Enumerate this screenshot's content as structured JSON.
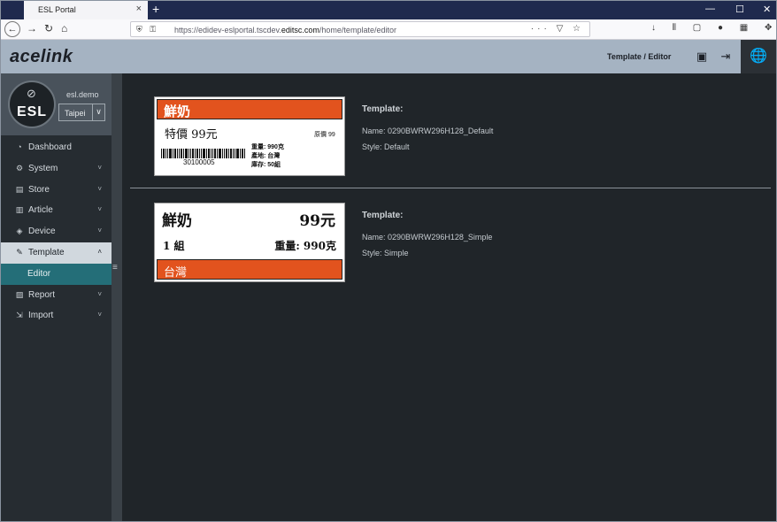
{
  "browser": {
    "tab_title": "ESL Portal",
    "tab_close": "×",
    "new_tab": "+",
    "url_prefix": "https://edidev-eslportal.tscdev.",
    "url_domain": "editsc.com",
    "url_path": "/home/template/editor",
    "url_icons": "⛨ ⚿",
    "url_actions": "··· ▽ ☆",
    "back": "←",
    "forward": "→",
    "reload": "↻",
    "home": "⌂",
    "minimize": "—",
    "maximize": "☐",
    "close": "✕",
    "tool_icons": "↓ ⫴ ▢ ● ▦ ✥ ≡"
  },
  "header": {
    "logo": "acelink",
    "breadcrumb": "Template / Editor",
    "contact_icon": "▣",
    "logout_icon": "⇥",
    "globe_icon": "🌐"
  },
  "profile": {
    "avatar_text": "ESL",
    "avatar_mark": "⊘",
    "username": "esl.demo",
    "store": "Taipei",
    "caret": "∨"
  },
  "menu": [
    {
      "label": "Dashboard",
      "icon": "◔",
      "caret": ""
    },
    {
      "label": "System",
      "icon": "⚙",
      "caret": "˅"
    },
    {
      "label": "Store",
      "icon": "▤",
      "caret": "˅"
    },
    {
      "label": "Article",
      "icon": "▥",
      "caret": "˅"
    },
    {
      "label": "Device",
      "icon": "◈",
      "caret": "˅"
    },
    {
      "label": "Template",
      "icon": "✎",
      "caret": "˄"
    },
    {
      "label": "Editor",
      "icon": "",
      "caret": ""
    },
    {
      "label": "Report",
      "icon": "▨",
      "caret": "˅"
    },
    {
      "label": "Import",
      "icon": "⇲",
      "caret": "˅"
    }
  ],
  "handle_grip": "≡",
  "templates": [
    {
      "info_title": "Template:",
      "name_line": "Name: 0290BWRW296H128_Default",
      "style_line": "Style: Default",
      "preview": {
        "product": "鮮奶",
        "price": "特價 99元",
        "orig_price": "原價 99",
        "barcode": "30100005",
        "spec1": "重量: 990克",
        "spec2": "產地: 台灣",
        "spec3": "庫存: 50組"
      }
    },
    {
      "info_title": "Template:",
      "name_line": "Name: 0290BWRW296H128_Simple",
      "style_line": "Style: Simple",
      "preview": {
        "product": "鮮奶",
        "price": "99元",
        "qty": "1 組",
        "weight": "重量: 990克",
        "origin": "台灣"
      }
    }
  ],
  "colors": {
    "accent_orange": "#e2531e",
    "active_teal": "#246e78",
    "header_bg": "#a5b3c2"
  }
}
